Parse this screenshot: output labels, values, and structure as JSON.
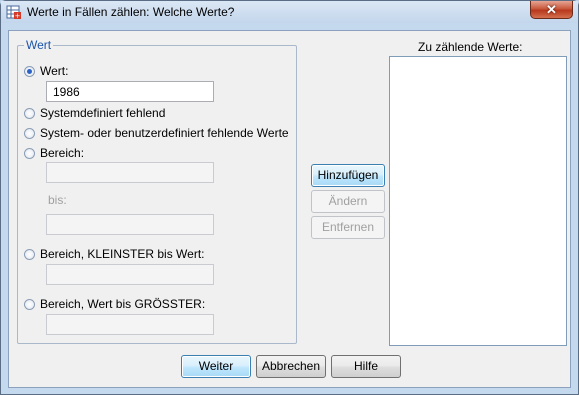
{
  "window": {
    "title": "Werte in Fällen zählen: Welche Werte?",
    "close_glyph": "✕"
  },
  "group": {
    "legend": "Wert",
    "options": {
      "wert": "Wert:",
      "sysmis": "Systemdefiniert fehlend",
      "sysuser": "System- oder benutzerdefiniert fehlende Werte",
      "bereich": "Bereich:",
      "bis": "bis:",
      "lowest": "Bereich, KLEINSTER bis Wert:",
      "highest": "Bereich, Wert bis GRÖSSTER:"
    },
    "wert_value": "1986",
    "selected": "wert"
  },
  "list": {
    "header": "Zu zählende Werte:"
  },
  "buttons": {
    "add": "Hinzufügen",
    "change": "Ändern",
    "remove": "Entfernen",
    "ok": "Weiter",
    "cancel": "Abbrechen",
    "help": "Hilfe"
  }
}
